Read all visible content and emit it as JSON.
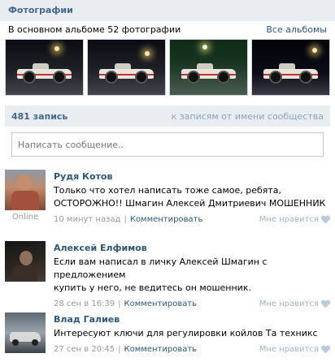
{
  "photos": {
    "title": "Фотографии",
    "subtitle": "В основном альбоме 52 фотографии",
    "all_albums": "Все альбомы",
    "thumbnails": [
      "car-night-photo",
      "car-night-photo",
      "car-gas-station-photo",
      "car-street-night-photo"
    ]
  },
  "wall": {
    "count": "481 запись",
    "from_community_link": "к записям от имени сообщества",
    "composer_placeholder": "Написать сообщение.."
  },
  "posts": [
    {
      "author": "Рудя Котов",
      "text_line1": "Только что хотел написать тоже самое, ребята,",
      "text_line2": "ОСТОРОЖНО!! Шмагин Алексей Дмитриевич МОШЕННИК",
      "time": "10 минут назад",
      "separator": "|",
      "comment": "Комментировать",
      "like": "Мне нравится",
      "status": "Online"
    },
    {
      "author": "Алексей Елфимов",
      "text_line1": "Если вам написал в личку Алексей Шмагин с предложением",
      "text_line2": "купить у него, не ведитесь он мошенник.",
      "time": "28 сен в 16:39",
      "separator": "|",
      "comment": "Комментировать",
      "like": "Мне нравится"
    },
    {
      "author": "Влад Галиев",
      "text_line1": "Интересуют ключи для регулировки койлов Та техникс",
      "time": "27 сен в 20:45",
      "separator": "|",
      "comment": "Комментировать",
      "like": "Мне нравится"
    }
  ],
  "colors": {
    "header_bg": "#e9edf1",
    "link": "#2b587a",
    "header_text": "#45688e"
  }
}
